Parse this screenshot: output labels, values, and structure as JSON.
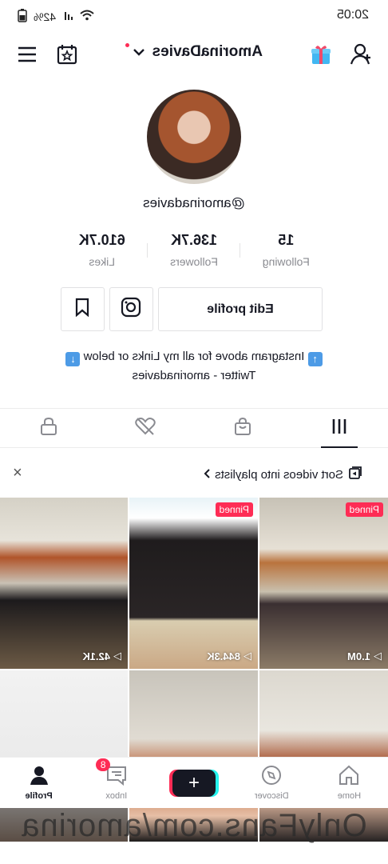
{
  "status_bar": {
    "time": "20:05",
    "battery": "42%"
  },
  "header": {
    "username": "AmorinaDavies",
    "icons": [
      "menu-icon",
      "calendar-star-icon",
      "gift-icon",
      "add-user-icon"
    ]
  },
  "profile": {
    "handle": "@amorinadavies",
    "stats": [
      {
        "value": "15",
        "label": "Following"
      },
      {
        "value": "136.7K",
        "label": "Followers"
      },
      {
        "value": "610.7K",
        "label": "Likes"
      }
    ],
    "edit_label": "Edit profile",
    "bio_line1": "Instagram above for all my Links or below",
    "bio_line2": "Twitter - amorinadavies"
  },
  "tabs": [
    "videos-grid-icon",
    "shop-bag-icon",
    "liked-hidden-icon",
    "private-lock-icon"
  ],
  "playlist_bar": {
    "text": "Sort videos into playlists"
  },
  "videos": [
    {
      "views": "1.0M",
      "pinned": "Pinned"
    },
    {
      "views": "844.3K",
      "pinned": "Pinned"
    },
    {
      "views": "42.1K",
      "pinned": ""
    },
    {
      "views": "",
      "pinned": ""
    },
    {
      "views": "",
      "pinned": ""
    },
    {
      "views": "",
      "pinned": ""
    }
  ],
  "bottom_nav": {
    "home": "Home",
    "discover": "Discover",
    "inbox": "Inbox",
    "inbox_badge": "8",
    "profile": "Profile"
  },
  "watermark": "OnlyFans.com/amorina",
  "colors": {
    "accent": "#fe2c55",
    "cyan": "#25f4ee",
    "text": "#161823",
    "muted": "#8a8b91"
  }
}
